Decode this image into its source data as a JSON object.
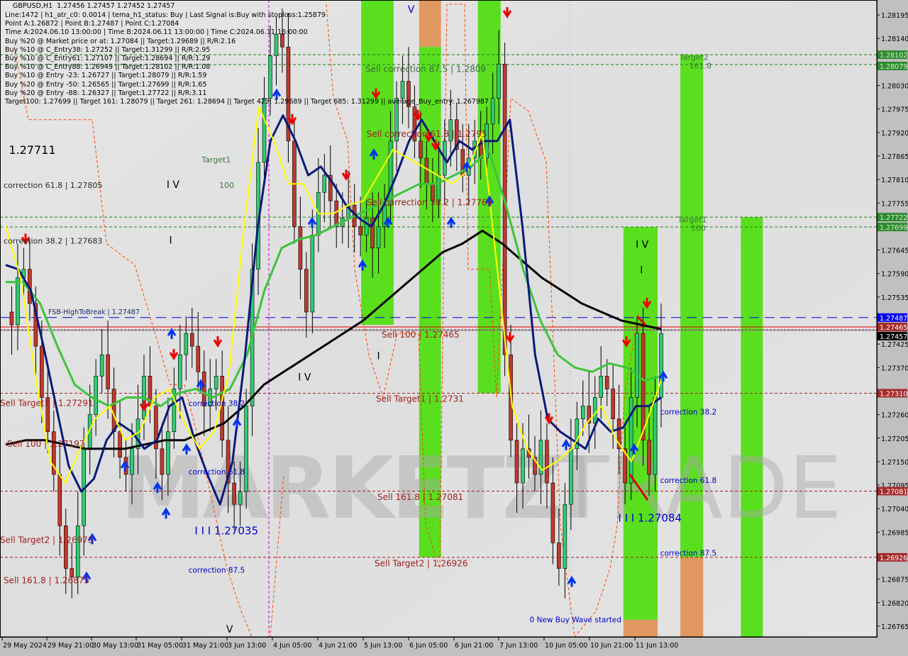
{
  "window": {
    "symbol": "GBPUSD,H1",
    "ohlc": "1.27456 1.27457 1.27452 1.27457"
  },
  "info_lines": [
    "Line:1472 | h1_atr_c0: 0.0014 | tema_h1_status: Buy | Last Signal is:Buy with stoploss:1.25879",
    "Point A:1.26872 | Point B:1.27487 | Point C:1.27084",
    "Time A:2024.06.10 13:00:00 | Time B:2024.06.11 13:00:00 | Time C:2024.06.11 16:00:00",
    "Buy %20 @ Market price or at: 1.27084 || Target:1.29689 || R/R:2.16",
    "Buy %10 @ C_Entry38: 1.27252 || Target:1.31299 || R/R:2.95",
    "Buy %10 @ C_Entry61: 1.27107 || Target:1.28694 || R/R:1.29",
    "Buy %10 @ C_Entry88: 1.26949 || Target:1.28102 || R/R:1.08",
    "Buy %10 @ Entry -23: 1.26727 || Target:1.28079 || R/R:1.59",
    "Buy %20 @ Entry -50: 1.26565 || Target:1.27699 || R/R:1.65",
    "Buy %20 @ Entry -88: 1.26327 || Target:1.27722 || R/R:3.11",
    "Target100: 1.27699 || Target 161: 1.28079 || Target 261: 1.28694 || Target 423: 1.29689 || Target 685: 1.31299 || average_Buy_entry: 1.267987"
  ],
  "watermark": {
    "left": "MARKETZI",
    "right": "TRADE"
  },
  "colors": {
    "background": "#e0e0e0",
    "axis_bg": "#c0c0c0",
    "green_zone": "#5adf1e",
    "orange_zone": "#e09860",
    "bull_candle": "#2ecc71",
    "bear_candle": "#c0392b",
    "ema_navy": "#0a1a7a",
    "ema_yellow": "#ffff00",
    "ema_green": "#3cc43c",
    "ema_black": "#000000",
    "sell_line": "#a02020",
    "buy_target_line": "#1a7a1a",
    "fsb_line": "#0000e0",
    "correction_text": "#0000cc"
  },
  "chart_data": {
    "type": "candlestick",
    "title": "GBPUSD,H1",
    "ylim": [
      1.2674,
      1.2823
    ],
    "y_ticks": [
      "1.28195",
      "1.28140",
      "1.28030",
      "1.27975",
      "1.27920",
      "1.27865",
      "1.27810",
      "1.27755",
      "1.27645",
      "1.27590",
      "1.27535",
      "1.27425",
      "1.27370",
      "1.27260",
      "1.27205",
      "1.27150",
      "1.27095",
      "1.27040",
      "1.26985",
      "1.26875",
      "1.26820",
      "1.26765"
    ],
    "x_ticks": [
      "29 May 2024",
      "29 May 21:00",
      "30 May 13:00",
      "31 May 05:00",
      "31 May 21:00",
      "3 Jun 13:00",
      "4 Jun 05:00",
      "4 Jun 21:00",
      "5 Jun 13:00",
      "6 Jun 05:00",
      "6 Jun 21:00",
      "7 Jun 13:00",
      "10 Jun 05:00",
      "10 Jun 21:00",
      "11 Jun 13:00"
    ],
    "price_tags": [
      {
        "value": "1.28102",
        "kind": "green"
      },
      {
        "value": "1.28079",
        "kind": "green"
      },
      {
        "value": "1.27722",
        "kind": "green"
      },
      {
        "value": "1.27699",
        "kind": "green"
      },
      {
        "value": "1.27487",
        "kind": "blue"
      },
      {
        "value": "1.27465",
        "kind": "red"
      },
      {
        "value": "1.27457",
        "kind": "black"
      },
      {
        "value": "1.27310",
        "kind": "red"
      },
      {
        "value": "1.27081",
        "kind": "red"
      },
      {
        "value": "1.26926",
        "kind": "red"
      }
    ],
    "horizontal_levels": [
      {
        "label": "Sell correction 87.5 | 1.2809",
        "price": 1.28079,
        "style": "green-dash"
      },
      {
        "label": "",
        "price": 1.28102,
        "style": "green-dash"
      },
      {
        "label": "Target1",
        "price": 1.27722,
        "style": "green-dash"
      },
      {
        "label": "100",
        "price": 1.27699,
        "style": "green-dash"
      },
      {
        "label": "FSB-HighToBreak | 1.27487",
        "price": 1.27487,
        "style": "blue-dash"
      },
      {
        "label": "Sell 100 | 1.27465",
        "price": 1.27465,
        "style": "red-solid"
      },
      {
        "label": "Sell Target1 | 1.2731",
        "price": 1.2731,
        "style": "red-dash"
      },
      {
        "label": "Sell 161.8 | 1.27081",
        "price": 1.27081,
        "style": "red-dash"
      },
      {
        "label": "Sell Target2 | 1.26926",
        "price": 1.26926,
        "style": "red-dash"
      }
    ],
    "annotations": [
      {
        "text": "1.27711",
        "price": 1.2787,
        "x_frac": 0.01
      },
      {
        "text": "correction 61.8 | 1.27805",
        "price": 1.2779,
        "x_frac": 0.004
      },
      {
        "text": "correction 38.2 | 1.27683",
        "price": 1.2766,
        "x_frac": 0.004
      },
      {
        "text": "Sell Target1 | 1.27291",
        "price": 1.2728,
        "x_frac": 0.0
      },
      {
        "text": "Sell 100 | 1.27197",
        "price": 1.27185,
        "x_frac": 0.008
      },
      {
        "text": "Sell Target2 | 1.26973",
        "price": 1.2696,
        "x_frac": 0.0
      },
      {
        "text": "Sell 161.8 | 1.26875",
        "price": 1.26865,
        "x_frac": 0.004
      },
      {
        "text": "Target1",
        "price": 1.2785,
        "x_frac": 0.23
      },
      {
        "text": "100",
        "price": 1.2779,
        "x_frac": 0.25
      },
      {
        "text": "Sell correction 61.8 | 1.2795",
        "price": 1.2791,
        "x_frac": 0.418
      },
      {
        "text": "Sell correction 38.2 | 1.27764",
        "price": 1.2775,
        "x_frac": 0.418
      },
      {
        "text": "Target2",
        "price": 1.2809,
        "x_frac": 0.775
      },
      {
        "text": "161.8",
        "price": 1.2807,
        "x_frac": 0.786
      },
      {
        "text": "Target1",
        "price": 1.2771,
        "x_frac": 0.773
      },
      {
        "text": "100",
        "price": 1.2769,
        "x_frac": 0.788
      }
    ],
    "blue_annotations": [
      {
        "text": "correction 38.2",
        "x_frac": 0.215,
        "price": 1.2728
      },
      {
        "text": "correction 61.8",
        "x_frac": 0.215,
        "price": 1.2712
      },
      {
        "text": "I I I 1.27035",
        "x_frac": 0.222,
        "price": 1.2698,
        "big": true
      },
      {
        "text": "correction 87.5",
        "x_frac": 0.215,
        "price": 1.2689
      },
      {
        "text": "correction 38.2",
        "x_frac": 0.753,
        "price": 1.2726
      },
      {
        "text": "correction 61.8",
        "x_frac": 0.753,
        "price": 1.271
      },
      {
        "text": "I I I 1.27084",
        "x_frac": 0.705,
        "price": 1.2701,
        "big": true
      },
      {
        "text": "correction 87.5",
        "x_frac": 0.753,
        "price": 1.2693
      },
      {
        "text": "0 New Buy Wave started",
        "x_frac": 0.604,
        "price": 1.26774
      }
    ],
    "wave_labels": [
      {
        "text": "I V",
        "x_frac": 0.19,
        "price": 1.2779
      },
      {
        "text": "I",
        "x_frac": 0.193,
        "price": 1.2766
      },
      {
        "text": "I V",
        "x_frac": 0.34,
        "price": 1.2734
      },
      {
        "text": "V",
        "x_frac": 0.465,
        "price": 1.282
      },
      {
        "text": "I V",
        "x_frac": 0.725,
        "price": 1.2765
      },
      {
        "text": "I",
        "x_frac": 0.73,
        "price": 1.2759
      },
      {
        "text": "V",
        "x_frac": 0.258,
        "price": 1.2675
      },
      {
        "text": "I",
        "x_frac": 0.43,
        "price": 1.2739
      }
    ],
    "zones": [
      {
        "x_frac": [
          0.412,
          0.449
        ],
        "price_top": 1.2823,
        "price_bot": 1.2747,
        "color": "green"
      },
      {
        "x_frac": [
          0.478,
          0.503
        ],
        "price_top": 1.2823,
        "price_bot": 1.2812,
        "color": "orange"
      },
      {
        "x_frac": [
          0.478,
          0.503
        ],
        "price_top": 1.2812,
        "price_bot": 1.26926,
        "color": "green"
      },
      {
        "x_frac": [
          0.545,
          0.571
        ],
        "price_top": 1.2823,
        "price_bot": 1.2731,
        "color": "green"
      },
      {
        "x_frac": [
          0.711,
          0.75
        ],
        "price_top": 1.27699,
        "price_bot": 1.2678,
        "color": "green"
      },
      {
        "x_frac": [
          0.711,
          0.75
        ],
        "price_top": 1.2678,
        "price_bot": 1.2674,
        "color": "orange"
      },
      {
        "x_frac": [
          0.776,
          0.802
        ],
        "price_top": 1.28102,
        "price_bot": 1.26926,
        "color": "green"
      },
      {
        "x_frac": [
          0.776,
          0.802
        ],
        "price_top": 1.26926,
        "price_bot": 1.2674,
        "color": "orange"
      },
      {
        "x_frac": [
          0.845,
          0.87
        ],
        "price_top": 1.27722,
        "price_bot": 1.2674,
        "color": "green"
      }
    ],
    "close_series": [
      1.275,
      1.2747,
      1.2758,
      1.276,
      1.2752,
      1.2742,
      1.273,
      1.2722,
      1.2712,
      1.27,
      1.269,
      1.2688,
      1.27,
      1.2718,
      1.2726,
      1.2735,
      1.274,
      1.2732,
      1.2722,
      1.2716,
      1.2712,
      1.2718,
      1.2725,
      1.2735,
      1.2728,
      1.2718,
      1.2712,
      1.2722,
      1.2732,
      1.274,
      1.2745,
      1.2742,
      1.2736,
      1.2728,
      1.2732,
      1.2735,
      1.272,
      1.271,
      1.2705,
      1.2708,
      1.2728,
      1.276,
      1.2785,
      1.28,
      1.281,
      1.2815,
      1.2812,
      1.279,
      1.277,
      1.276,
      1.275,
      1.2768,
      1.2778,
      1.2782,
      1.2776,
      1.277,
      1.2772,
      1.2775,
      1.277,
      1.2768,
      1.2772,
      1.2765,
      1.277,
      1.2775,
      1.279,
      1.28,
      1.2804,
      1.2798,
      1.279,
      1.2786,
      1.278,
      1.2776,
      1.2782,
      1.279,
      1.2795,
      1.2788,
      1.2782,
      1.2786,
      1.279,
      1.2786,
      1.2794,
      1.28,
      1.2808,
      1.274,
      1.272,
      1.271,
      1.2718,
      1.2716,
      1.2712,
      1.272,
      1.271,
      1.2696,
      1.269,
      1.2705,
      1.2718,
      1.2725,
      1.2728,
      1.2724,
      1.273,
      1.2735,
      1.2732,
      1.2725,
      1.2718,
      1.271,
      1.273,
      1.2745,
      1.272,
      1.2712,
      1.273,
      1.2745
    ],
    "ema_navy": [
      1.2761,
      1.276,
      1.2755,
      1.2742,
      1.2728,
      1.2714,
      1.2708,
      1.2711,
      1.272,
      1.2724,
      1.2722,
      1.2718,
      1.272,
      1.2728,
      1.273,
      1.272,
      1.2712,
      1.2705,
      1.2715,
      1.274,
      1.277,
      1.279,
      1.2796,
      1.279,
      1.2782,
      1.2784,
      1.278,
      1.2775,
      1.2772,
      1.277,
      1.2775,
      1.2782,
      1.279,
      1.2795,
      1.279,
      1.2785,
      1.279,
      1.2788,
      1.279,
      1.279,
      1.2795,
      1.277,
      1.274,
      1.2725,
      1.2722,
      1.272,
      1.2718,
      1.2725,
      1.2722,
      1.2723,
      1.2728,
      1.2728,
      1.273
    ],
    "ema_yellow": [
      1.277,
      1.2758,
      1.2735,
      1.2715,
      1.271,
      1.2718,
      1.2725,
      1.2728,
      1.272,
      1.2722,
      1.273,
      1.2732,
      1.2724,
      1.2718,
      1.2722,
      1.2736,
      1.277,
      1.2798,
      1.279,
      1.278,
      1.278,
      1.2773,
      1.2773,
      1.2775,
      1.2776,
      1.2782,
      1.2788,
      1.2786,
      1.2784,
      1.2782,
      1.278,
      1.2783,
      1.2792,
      1.276,
      1.2728,
      1.2718,
      1.2713,
      1.2715,
      1.2718,
      1.2724,
      1.2728,
      1.272,
      1.2715,
      1.2724,
      1.2734
    ],
    "ema_green": [
      1.2757,
      1.2757,
      1.2752,
      1.2742,
      1.2733,
      1.273,
      1.2728,
      1.273,
      1.273,
      1.2728,
      1.2731,
      1.2732,
      1.273,
      1.2732,
      1.274,
      1.2755,
      1.2765,
      1.2767,
      1.2768,
      1.277,
      1.2772,
      1.2774,
      1.2776,
      1.2778,
      1.278,
      1.278,
      1.2782,
      1.2784,
      1.2788,
      1.2775,
      1.276,
      1.2748,
      1.274,
      1.2737,
      1.2736,
      1.2738,
      1.2737,
      1.2734,
      1.2735
    ],
    "ema_black": [
      1.2719,
      1.272,
      1.272,
      1.2719,
      1.2718,
      1.2718,
      1.2718,
      1.2719,
      1.272,
      1.272,
      1.2722,
      1.2724,
      1.2728,
      1.2733,
      1.2736,
      1.2739,
      1.2742,
      1.2745,
      1.2748,
      1.2752,
      1.2756,
      1.276,
      1.2764,
      1.2766,
      1.2769,
      1.2766,
      1.2762,
      1.2758,
      1.2755,
      1.2752,
      1.275,
      1.2748,
      1.2747,
      1.2746
    ]
  }
}
